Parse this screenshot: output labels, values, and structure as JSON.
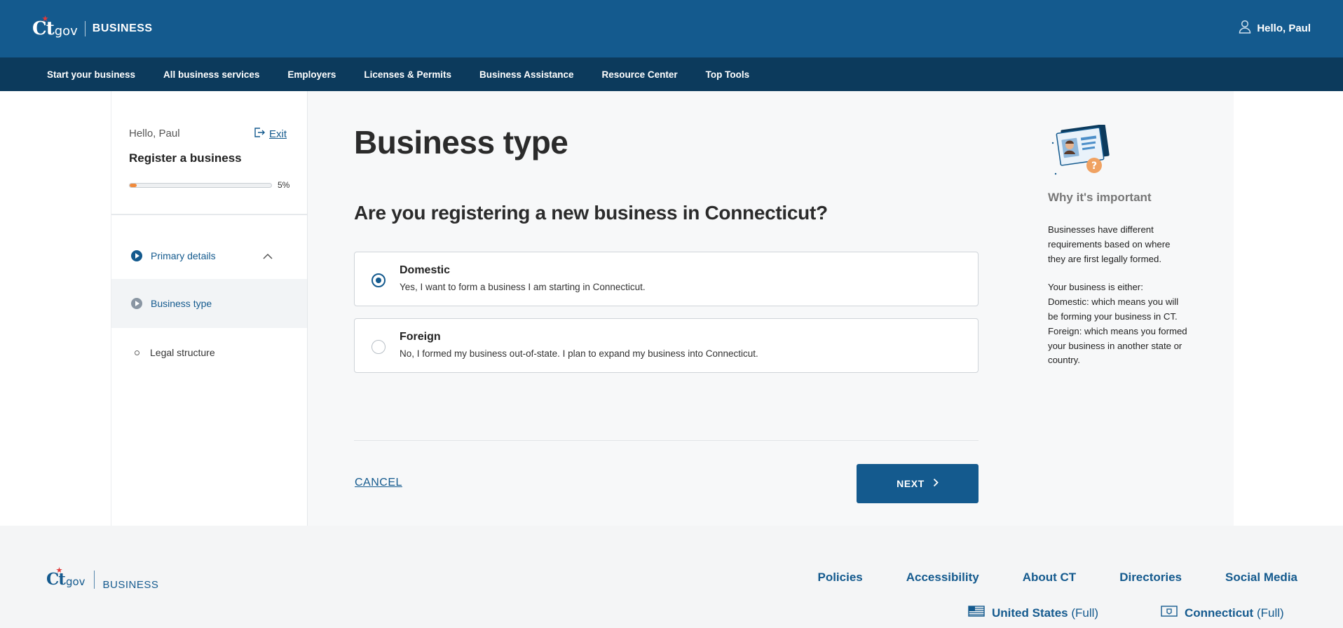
{
  "header": {
    "logo_ct": "Ct",
    "logo_gov": "gov",
    "logo_business": "BUSINESS",
    "user_greeting": "Hello, Paul"
  },
  "nav": {
    "items": [
      {
        "label": "Start your business"
      },
      {
        "label": "All business services"
      },
      {
        "label": "Employers"
      },
      {
        "label": "Licenses & Permits"
      },
      {
        "label": "Business Assistance"
      },
      {
        "label": "Resource Center"
      },
      {
        "label": "Top Tools"
      }
    ]
  },
  "sidebar": {
    "greeting": "Hello, Paul",
    "exit_label": "Exit",
    "title": "Register a business",
    "progress": {
      "value": 0.05,
      "label": "5%"
    },
    "section": {
      "label": "Primary details",
      "expanded": true
    },
    "steps": [
      {
        "label": "Business type",
        "status": "current"
      },
      {
        "label": "Legal structure",
        "status": "upcoming"
      }
    ]
  },
  "main": {
    "title": "Business type",
    "question": "Are you registering a new business in Connecticut?",
    "options": [
      {
        "title": "Domestic",
        "description": "Yes, I want to form a business I am starting in Connecticut.",
        "selected": true
      },
      {
        "title": "Foreign",
        "description": "No, I formed my business out-of-state. I plan to expand my business into Connecticut.",
        "selected": false
      }
    ],
    "cancel_label": "CANCEL",
    "next_label": "NEXT"
  },
  "info": {
    "title": "Why it's important",
    "paragraph1": "Businesses have different requirements based on where they are first legally formed.",
    "line_either": "Your business is either:",
    "line_domestic": "Domestic: which means you will be forming your business in CT.",
    "line_foreign": "Foreign: which means you formed your business in another state or country."
  },
  "footer": {
    "logo_ct": "Ct",
    "logo_gov": "gov",
    "logo_business": "BUSINESS",
    "links": [
      {
        "label": "Policies"
      },
      {
        "label": "Accessibility"
      },
      {
        "label": "About CT"
      },
      {
        "label": "Directories"
      },
      {
        "label": "Social Media"
      }
    ],
    "us_full": {
      "name": "United States",
      "suffix": "(Full)"
    },
    "ct_full": {
      "name": "Connecticut",
      "suffix": "(Full)"
    }
  },
  "colors": {
    "brand_blue": "#145a8e",
    "nav_dark": "#0c3a5c",
    "progress_orange": "#f08a3c"
  }
}
